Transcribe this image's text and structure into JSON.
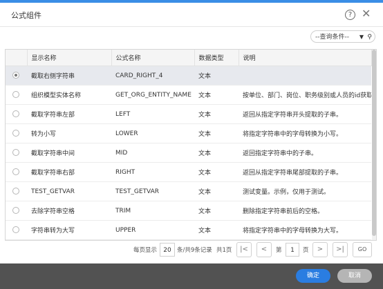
{
  "dialog": {
    "title": "公式组件"
  },
  "query": {
    "label": "--查询条件--"
  },
  "columns": [
    "显示名称",
    "公式名称",
    "数据类型",
    "说明"
  ],
  "rows": [
    {
      "display": "截取右侧字符串",
      "formula": "CARD_RIGHT_4",
      "type": "文本",
      "desc": "",
      "selected": true
    },
    {
      "display": "组织模型实体名称",
      "formula": "GET_ORG_ENTITY_NAME",
      "type": "文本",
      "desc": "按单位、部门、岗位、职务级别或人员的id获取实...",
      "selected": false
    },
    {
      "display": "截取字符串左部",
      "formula": "LEFT",
      "type": "文本",
      "desc": "返回从指定字符串开头提取的子串。",
      "selected": false
    },
    {
      "display": "转为小写",
      "formula": "LOWER",
      "type": "文本",
      "desc": "将指定字符串中的字母转换为小写。",
      "selected": false
    },
    {
      "display": "截取字符串中间",
      "formula": "MID",
      "type": "文本",
      "desc": "返回指定字符串中的子串。",
      "selected": false
    },
    {
      "display": "截取字符串右部",
      "formula": "RIGHT",
      "type": "文本",
      "desc": "返回从指定字符串尾部提取的子串。",
      "selected": false
    },
    {
      "display": "TEST_GETVAR",
      "formula": "TEST_GETVAR",
      "type": "文本",
      "desc": "测试变量。示例，仅用于测试。",
      "selected": false
    },
    {
      "display": "去除字符串空格",
      "formula": "TRIM",
      "type": "文本",
      "desc": "删除指定字符串前后的空格。",
      "selected": false
    },
    {
      "display": "字符串转为大写",
      "formula": "UPPER",
      "type": "文本",
      "desc": "将指定字符串中的字母转换为大写。",
      "selected": false
    }
  ],
  "pager": {
    "per_page_label": "每页显示",
    "per_page": "20",
    "total_label": "条/共9条记录",
    "pages_label": "共1页",
    "page_prefix": "第",
    "page": "1",
    "page_suffix": "页",
    "go_label": "GO"
  },
  "footer": {
    "ok_label": "确定",
    "cancel_label": "取消"
  },
  "colors": {
    "accent": "#2a7de1",
    "footer_bg": "#525252",
    "selected_row": "#e7e9ee"
  }
}
